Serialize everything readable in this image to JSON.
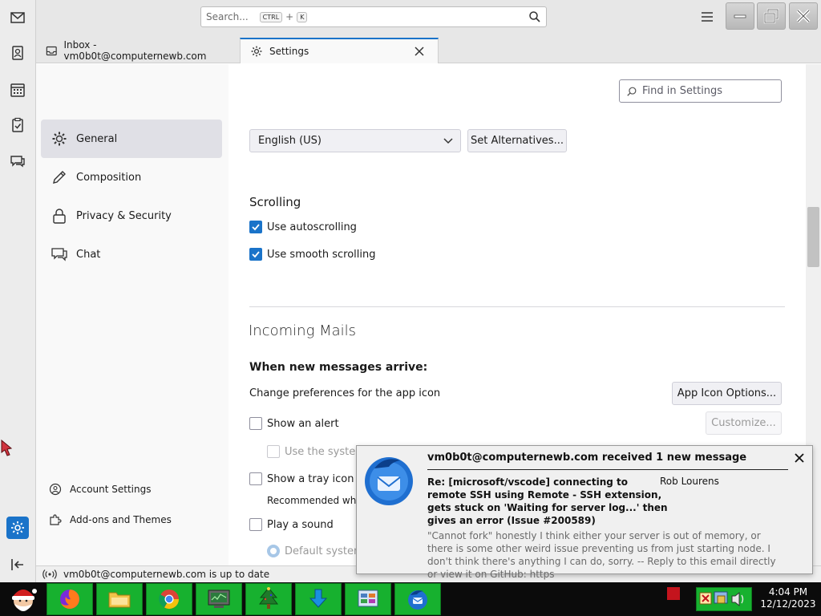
{
  "titlebar": {
    "search_placeholder": "Search...",
    "shortcut_key1": "CTRL",
    "shortcut_plus": "+",
    "shortcut_key2": "K"
  },
  "tabs": [
    {
      "label": "Inbox - vm0b0t@computernewb.com",
      "icon": "inbox-icon"
    },
    {
      "label": "Settings",
      "icon": "gear-icon",
      "active": true
    }
  ],
  "settings_nav": {
    "items": [
      {
        "label": "General",
        "icon": "gear-icon",
        "active": true
      },
      {
        "label": "Composition",
        "icon": "pencil-icon"
      },
      {
        "label": "Privacy & Security",
        "icon": "lock-icon"
      },
      {
        "label": "Chat",
        "icon": "chat-icon"
      }
    ],
    "account_settings": "Account Settings",
    "addons": "Add-ons and Themes"
  },
  "content": {
    "find_placeholder": "Find in Settings",
    "language_value": "English (US)",
    "set_alternatives": "Set Alternatives...",
    "scrolling_heading": "Scrolling",
    "use_autoscrolling": "Use autoscrolling",
    "use_smooth_scrolling": "Use smooth scrolling",
    "incoming_heading": "Incoming Mails",
    "when_new_messages": "When new messages arrive:",
    "change_prefs": "Change preferences for the app icon",
    "app_icon_options": "App Icon Options...",
    "show_alert": "Show an alert",
    "customize": "Customize...",
    "use_system": "Use the system",
    "show_tray_icon": "Show a tray icon fo",
    "recommended_when": "Recommended when",
    "play_sound": "Play a sound",
    "default_system": "Default system"
  },
  "statusbar": {
    "text": "vm0b0t@computernewb.com is up to date"
  },
  "notification": {
    "title": "vm0b0t@computernewb.com received 1 new message",
    "subject": "Re: [microsoft/vscode] connecting to remote SSH using Remote - SSH extension, gets stuck on 'Waiting for server log...' then gives an error (Issue #200589)",
    "sender": "Rob Lourens",
    "preview": "\"Cannot fork\" honestly I think either your server is out of memory, or there is some other weird issue preventing us from just starting node. I don't think there's anything I can do, sorry. -- Reply to this email directly or view it on GitHub: https"
  },
  "taskbar": {
    "time": "4:04 PM",
    "date": "12/12/2023"
  },
  "colors": {
    "accent": "#1a73c9",
    "taskbar_green": "#17b12f",
    "taskbar_bg": "#0b0b0b"
  }
}
